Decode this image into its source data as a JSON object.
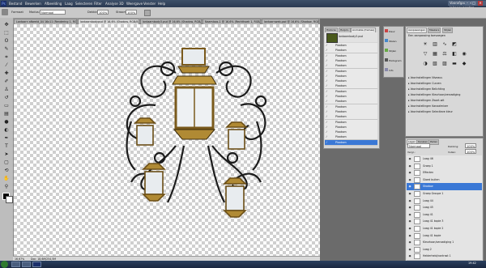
{
  "menubar": {
    "app_icon": "Ps",
    "items": [
      "Bestand",
      "Bewerken",
      "Afbeelding",
      "Laag",
      "Selecteren",
      "Filter",
      "Analyse",
      "3D",
      "Weergave",
      "Venster",
      "Help"
    ],
    "workspace": "Voorafgaande inkoopwaarden",
    "min": "–",
    "max": "□",
    "close": "✕"
  },
  "options": {
    "tool_label": "Formaat",
    "mode_label": "Modus:",
    "mode_value": "Normaal",
    "opacity_label": "Dekking:",
    "opacity_value": "100%",
    "flow_label": "Stroom:",
    "flow_value": "100%"
  },
  "tabs": [
    "Lantaarn afbeeld_04 16x11 (Rendering 1, RGB/8#) *",
    "lantaarnbodypsd @ 16,6% (Shadow, RGB/8#) *",
    "lantaarnbody3.psd @ 16,6% (Shadow, RGB/8#) *",
    "Naamloos-1 @ 16,6% (Rechthoek 1, RGB/8)",
    "lantaarnweb.psd @ 16,6% (Shadow, RGB/8#)"
  ],
  "status": {
    "zoom": "16,67%",
    "doc": "Doc: 18,6M/254,5M"
  },
  "animation": {
    "tabs": [
      "Historie",
      "Hulpm.",
      "Animatie (frames)"
    ],
    "head_label": "lantaarnbody3.psd",
    "frames": [
      "Plaatsen",
      "Plaatsen",
      "Plaatsen",
      "Plaatsen",
      "Plaatsen",
      "Plaatsen",
      "Plaatsen",
      "Plaatsen",
      "Plaatsen",
      "Plaatsen",
      "Plaatsen",
      "Plaatsen",
      "Plaatsen",
      "Plaatsen",
      "Plaatsen",
      "Plaatsen",
      "Plaatsen",
      "Plaatsen",
      "Plaatsen",
      "Plaatsen"
    ]
  },
  "iconpanel": [
    "Kleur",
    "Stalen",
    "Stijlen",
    "Histogram",
    "Info"
  ],
  "adjustments": {
    "tabs": [
      "Aanpassingen",
      "Maskers",
      "Stijlen"
    ],
    "title": "Een aanpassing toevoegen",
    "presets": [
      "Voorinstellingen Niveaus",
      "Voorinstellingen Curven",
      "Voorinstellingen Belichting",
      "Voorinstellingen Kleurtoon/verzadiging",
      "Voorinstellingen Zwart-wit",
      "Voorinstellingen Kanaalmixer",
      "Voorinstellingen Selectieve kleur"
    ]
  },
  "layers": {
    "tabs": [
      "Lagen",
      "Kanalen",
      "Paden"
    ],
    "blend": "Normaal",
    "opacity_label": "Dekking:",
    "opacity": "100%",
    "fill_label": "Vullen:",
    "fill": "100%",
    "lock_label": "Vergr.:",
    "items": [
      {
        "name": "Laag 46",
        "sel": false
      },
      {
        "name": "Groep 1",
        "sel": false
      },
      {
        "name": "Effecten",
        "sel": false
      },
      {
        "name": "Gloed buiten",
        "sel": false
      },
      {
        "name": "Shadow",
        "sel": true
      },
      {
        "name": "Groep Groupe 1",
        "sel": false
      },
      {
        "name": "Laag 44",
        "sel": false
      },
      {
        "name": "Laag 45",
        "sel": false
      },
      {
        "name": "Laag 41",
        "sel": false
      },
      {
        "name": "Laag 41 kopie 3",
        "sel": false
      },
      {
        "name": "Laag 41 kopie 2",
        "sel": false
      },
      {
        "name": "Laag 41 kopie",
        "sel": false
      },
      {
        "name": "Kleurtoon/verzadiging 1",
        "sel": false
      },
      {
        "name": "Laag 2",
        "sel": false
      },
      {
        "name": "Helderheid/contrast 1",
        "sel": false
      }
    ]
  },
  "taskbar": {
    "clock": "19:42"
  }
}
